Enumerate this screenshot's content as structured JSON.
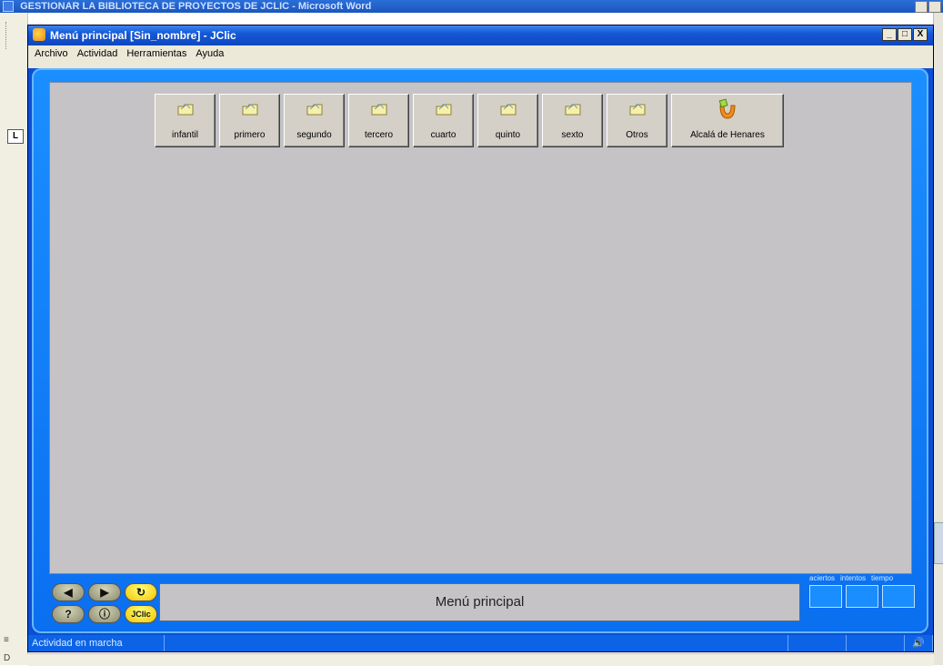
{
  "word": {
    "title": "GESTIONAR LA BIBLIOTECA DE PROYECTOS DE JCLIC - Microsoft Word",
    "ruler_marker": "L",
    "left_hint": "D"
  },
  "window": {
    "title": "Menú principal [Sin_nombre] - JClic",
    "controls": {
      "minimize": "_",
      "maximize": "□",
      "close": "X"
    }
  },
  "menu": [
    {
      "label": "Archivo"
    },
    {
      "label": "Actividad"
    },
    {
      "label": "Herramientas"
    },
    {
      "label": "Ayuda"
    }
  ],
  "folders": [
    {
      "label": "infantil",
      "icon": "folder-icon"
    },
    {
      "label": "primero",
      "icon": "folder-icon"
    },
    {
      "label": "segundo",
      "icon": "folder-icon"
    },
    {
      "label": "tercero",
      "icon": "folder-icon"
    },
    {
      "label": "cuarto",
      "icon": "folder-icon"
    },
    {
      "label": "quinto",
      "icon": "folder-icon"
    },
    {
      "label": "sexto",
      "icon": "folder-icon"
    },
    {
      "label": "Otros",
      "icon": "folder-icon"
    },
    {
      "label": "Alcalá de Henares",
      "icon": "jclic-project-icon"
    }
  ],
  "controls": {
    "back": "◀",
    "forward": "▶",
    "reload": "↻",
    "help": "?",
    "info": "ⓘ",
    "jclic": "JClic"
  },
  "message": "Menú principal",
  "counters": {
    "aciertos": "aciertos",
    "intentos": "intentos",
    "tiempo": "tiempo"
  },
  "status": {
    "text": "Actividad en marcha"
  },
  "colors": {
    "frame": "#1b8fff",
    "stage": "#c5c3c6",
    "button_yellow": "#f2c400"
  }
}
